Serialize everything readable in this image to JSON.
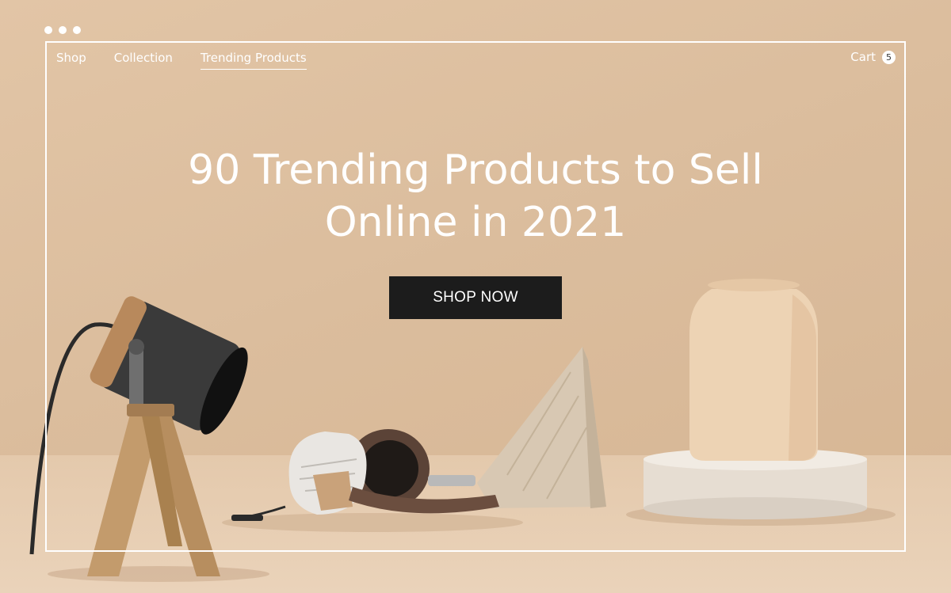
{
  "window": {
    "controls": [
      "dot",
      "dot",
      "dot"
    ]
  },
  "nav": {
    "items": [
      {
        "label": "Shop",
        "active": false
      },
      {
        "label": "Collection",
        "active": false
      },
      {
        "label": "Trending Products",
        "active": true
      }
    ]
  },
  "cart": {
    "label": "Cart",
    "count": "5"
  },
  "hero": {
    "headline_line1": "90 Trending Products to Sell",
    "headline_line2": "Online in 2021",
    "cta_label": "SHOP NOW"
  },
  "colors": {
    "background": "#dcbf9f",
    "frame": "#ffffff",
    "cta_bg": "#1c1c1c",
    "text": "#ffffff"
  },
  "products": [
    "lamp",
    "headphones",
    "marble-stone",
    "vase",
    "pedestal"
  ]
}
